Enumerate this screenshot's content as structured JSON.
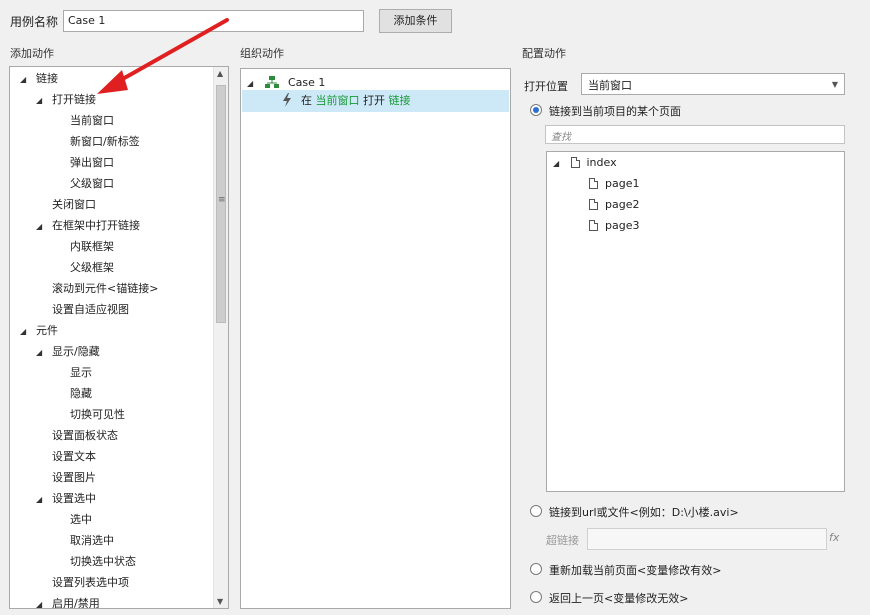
{
  "top": {
    "case_label": "用例名称",
    "case_value": "Case 1",
    "add_condition": "添加条件"
  },
  "titles": {
    "add_action": "添加动作",
    "organize_action": "组织动作",
    "configure_action": "配置动作"
  },
  "left_tree": [
    {
      "label": "链接",
      "expanded": true,
      "level": 0
    },
    {
      "label": "打开链接",
      "expanded": true,
      "level": 1
    },
    {
      "label": "当前窗口",
      "level": 2
    },
    {
      "label": "新窗口/新标签",
      "level": 2
    },
    {
      "label": "弹出窗口",
      "level": 2
    },
    {
      "label": "父级窗口",
      "level": 2
    },
    {
      "label": "关闭窗口",
      "level": 1
    },
    {
      "label": "在框架中打开链接",
      "expanded": true,
      "level": 1
    },
    {
      "label": "内联框架",
      "level": 2
    },
    {
      "label": "父级框架",
      "level": 2
    },
    {
      "label": "滚动到元件<锚链接>",
      "level": 1
    },
    {
      "label": "设置自适应视图",
      "level": 1
    },
    {
      "label": "元件",
      "expanded": true,
      "level": 0
    },
    {
      "label": "显示/隐藏",
      "expanded": true,
      "level": 1
    },
    {
      "label": "显示",
      "level": 2
    },
    {
      "label": "隐藏",
      "level": 2
    },
    {
      "label": "切换可见性",
      "level": 2
    },
    {
      "label": "设置面板状态",
      "level": 1
    },
    {
      "label": "设置文本",
      "level": 1
    },
    {
      "label": "设置图片",
      "level": 1
    },
    {
      "label": "设置选中",
      "expanded": true,
      "level": 1
    },
    {
      "label": "选中",
      "level": 2
    },
    {
      "label": "取消选中",
      "level": 2
    },
    {
      "label": "切换选中状态",
      "level": 2
    },
    {
      "label": "设置列表选中项",
      "level": 1
    },
    {
      "label": "启用/禁用",
      "expanded": true,
      "level": 1
    }
  ],
  "middle": {
    "case_name": "Case 1",
    "action_prefix": "在",
    "action_target": "当前窗口",
    "action_verb": "打开",
    "action_object": "链接"
  },
  "right": {
    "open_position_label": "打开位置",
    "open_position_value": "当前窗口",
    "radio_page": "链接到当前项目的某个页面",
    "search_placeholder": "查找",
    "pages": {
      "root": "index",
      "children": [
        "page1",
        "page2",
        "page3"
      ]
    },
    "radio_url": "链接到url或文件<例如：D:\\小楼.avi>",
    "hyperlink_label": "超链接",
    "fx": "fx",
    "radio_reload": "重新加载当前页面<变量修改有效>",
    "radio_back": "返回上一页<变量修改无效>"
  },
  "colors": {
    "accent_green": "#1a9a3a",
    "selection_bg": "#cde8f7",
    "arrow_red": "#e02020"
  }
}
